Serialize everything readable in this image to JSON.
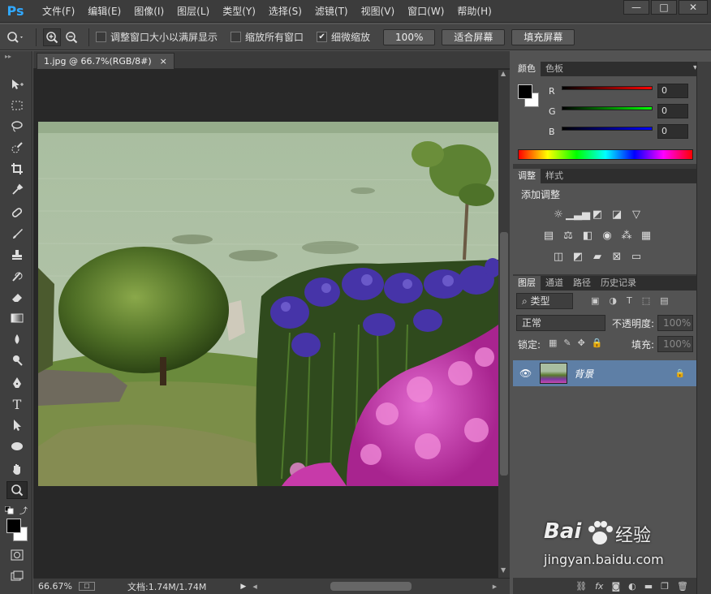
{
  "menubar": {
    "logo": "Ps",
    "items": [
      "文件(F)",
      "编辑(E)",
      "图像(I)",
      "图层(L)",
      "类型(Y)",
      "选择(S)",
      "滤镜(T)",
      "视图(V)",
      "窗口(W)",
      "帮助(H)"
    ]
  },
  "window_controls": {
    "minimize": "—",
    "maximize": "□",
    "close": "✕"
  },
  "options_bar": {
    "resize_windows_label": "调整窗口大小以满屏显示",
    "zoom_all_windows_label": "缩放所有窗口",
    "scrubby_zoom_label": "细微缩放",
    "scrubby_zoom_checked": true,
    "btn_100": "100%",
    "btn_fit": "适合屏幕",
    "btn_fill": "填充屏幕"
  },
  "document": {
    "tab_title": "1.jpg @ 66.7%(RGB/8#)",
    "tab_close": "×"
  },
  "status": {
    "zoom": "66.67%",
    "doc_size": "文档:1.74M/1.74M"
  },
  "color_panel": {
    "tabs": [
      "颜色",
      "色板"
    ],
    "r_label": "R",
    "g_label": "G",
    "b_label": "B",
    "r_value": "0",
    "g_value": "0",
    "b_value": "0",
    "fg_color": "#000000",
    "bg_color": "#ffffff"
  },
  "adjust_panel": {
    "tabs": [
      "调整",
      "样式"
    ],
    "title": "添加调整"
  },
  "layers_panel": {
    "tabs": [
      "图层",
      "通道",
      "路径",
      "历史记录"
    ],
    "filter_label": "类型",
    "blend_mode": "正常",
    "opacity_label": "不透明度:",
    "opacity_value": "100%",
    "lock_label": "锁定:",
    "fill_label": "填充:",
    "fill_value": "100%",
    "layer_name": "背景"
  },
  "footer_icons": [
    "link-icon",
    "fx-icon",
    "mask-icon",
    "adjustment-icon",
    "folder-icon",
    "new-layer-icon",
    "trash-icon"
  ],
  "watermark": {
    "brand": "Bai",
    "brand2": "经验",
    "url": "jingyan.baidu.com"
  }
}
